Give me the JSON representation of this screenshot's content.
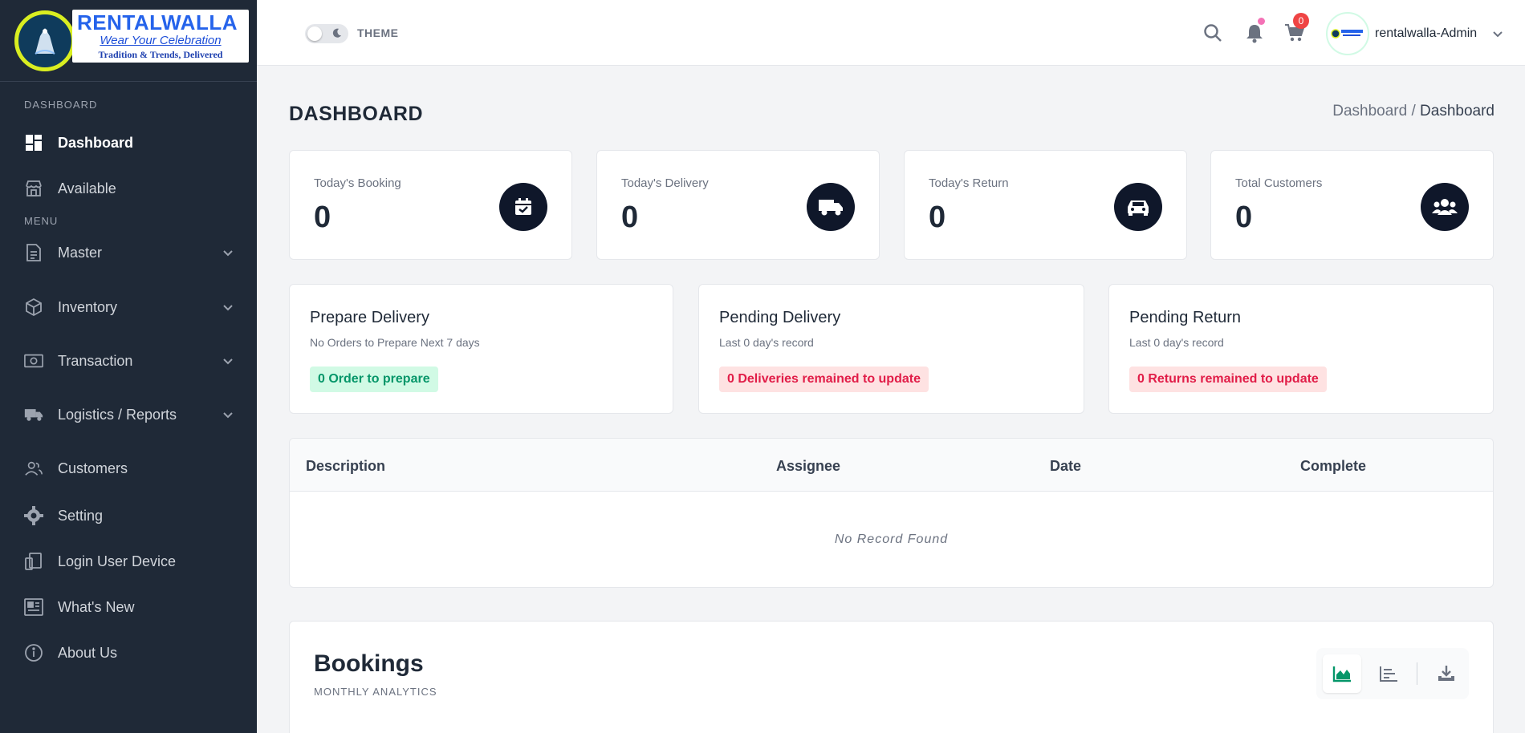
{
  "logo": {
    "title": "RENTALWALLA",
    "tagline": "Wear Your Celebration",
    "subtagline": "Tradition & Trends, Delivered"
  },
  "sidebar": {
    "section_dashboard": "DASHBOARD",
    "section_menu": "MENU",
    "items": [
      {
        "label": "Dashboard",
        "icon": "grid-icon",
        "active": true
      },
      {
        "label": "Available",
        "icon": "store-icon"
      },
      {
        "label": "Master",
        "icon": "document-icon",
        "expandable": true
      },
      {
        "label": "Inventory",
        "icon": "box-icon",
        "expandable": true
      },
      {
        "label": "Transaction",
        "icon": "money-icon",
        "expandable": true
      },
      {
        "label": "Logistics / Reports",
        "icon": "truck-icon",
        "expandable": true
      },
      {
        "label": "Customers",
        "icon": "users-icon"
      },
      {
        "label": "Setting",
        "icon": "gear-icon"
      },
      {
        "label": "Login User Device",
        "icon": "devices-icon"
      },
      {
        "label": "What's New",
        "icon": "newspaper-icon"
      },
      {
        "label": "About Us",
        "icon": "info-icon"
      }
    ]
  },
  "topbar": {
    "theme_label": "THEME",
    "cart_count": "0",
    "user_name": "rentalwalla-Admin"
  },
  "page": {
    "title": "DASHBOARD",
    "breadcrumb_root": "Dashboard",
    "breadcrumb_sep": " / ",
    "breadcrumb_current": "Dashboard"
  },
  "stats": [
    {
      "label": "Today's Booking",
      "value": "0",
      "icon": "calendar-check-icon"
    },
    {
      "label": "Today's Delivery",
      "value": "0",
      "icon": "truck-icon"
    },
    {
      "label": "Today's Return",
      "value": "0",
      "icon": "car-icon"
    },
    {
      "label": "Total Customers",
      "value": "0",
      "icon": "users-icon"
    }
  ],
  "panels": [
    {
      "title": "Prepare Delivery",
      "subtitle": "No Orders to Prepare Next 7 days",
      "pill": "0 Order to prepare",
      "tone": "green"
    },
    {
      "title": "Pending Delivery",
      "subtitle": "Last 0 day's record",
      "pill": "0 Deliveries remained to update",
      "tone": "red"
    },
    {
      "title": "Pending Return",
      "subtitle": "Last 0 day's record",
      "pill": "0 Returns remained to update",
      "tone": "red"
    }
  ],
  "table": {
    "headers": [
      "Description",
      "Assignee",
      "Date",
      "Complete"
    ],
    "empty_text": "No Record Found"
  },
  "bookings": {
    "title": "Bookings",
    "subtitle": "MONTHLY ANALYTICS"
  },
  "colors": {
    "sidebar_bg": "#1f2937",
    "accent_green": "#059669",
    "accent_red": "#e11d48",
    "icon_circle": "#0f172a"
  }
}
